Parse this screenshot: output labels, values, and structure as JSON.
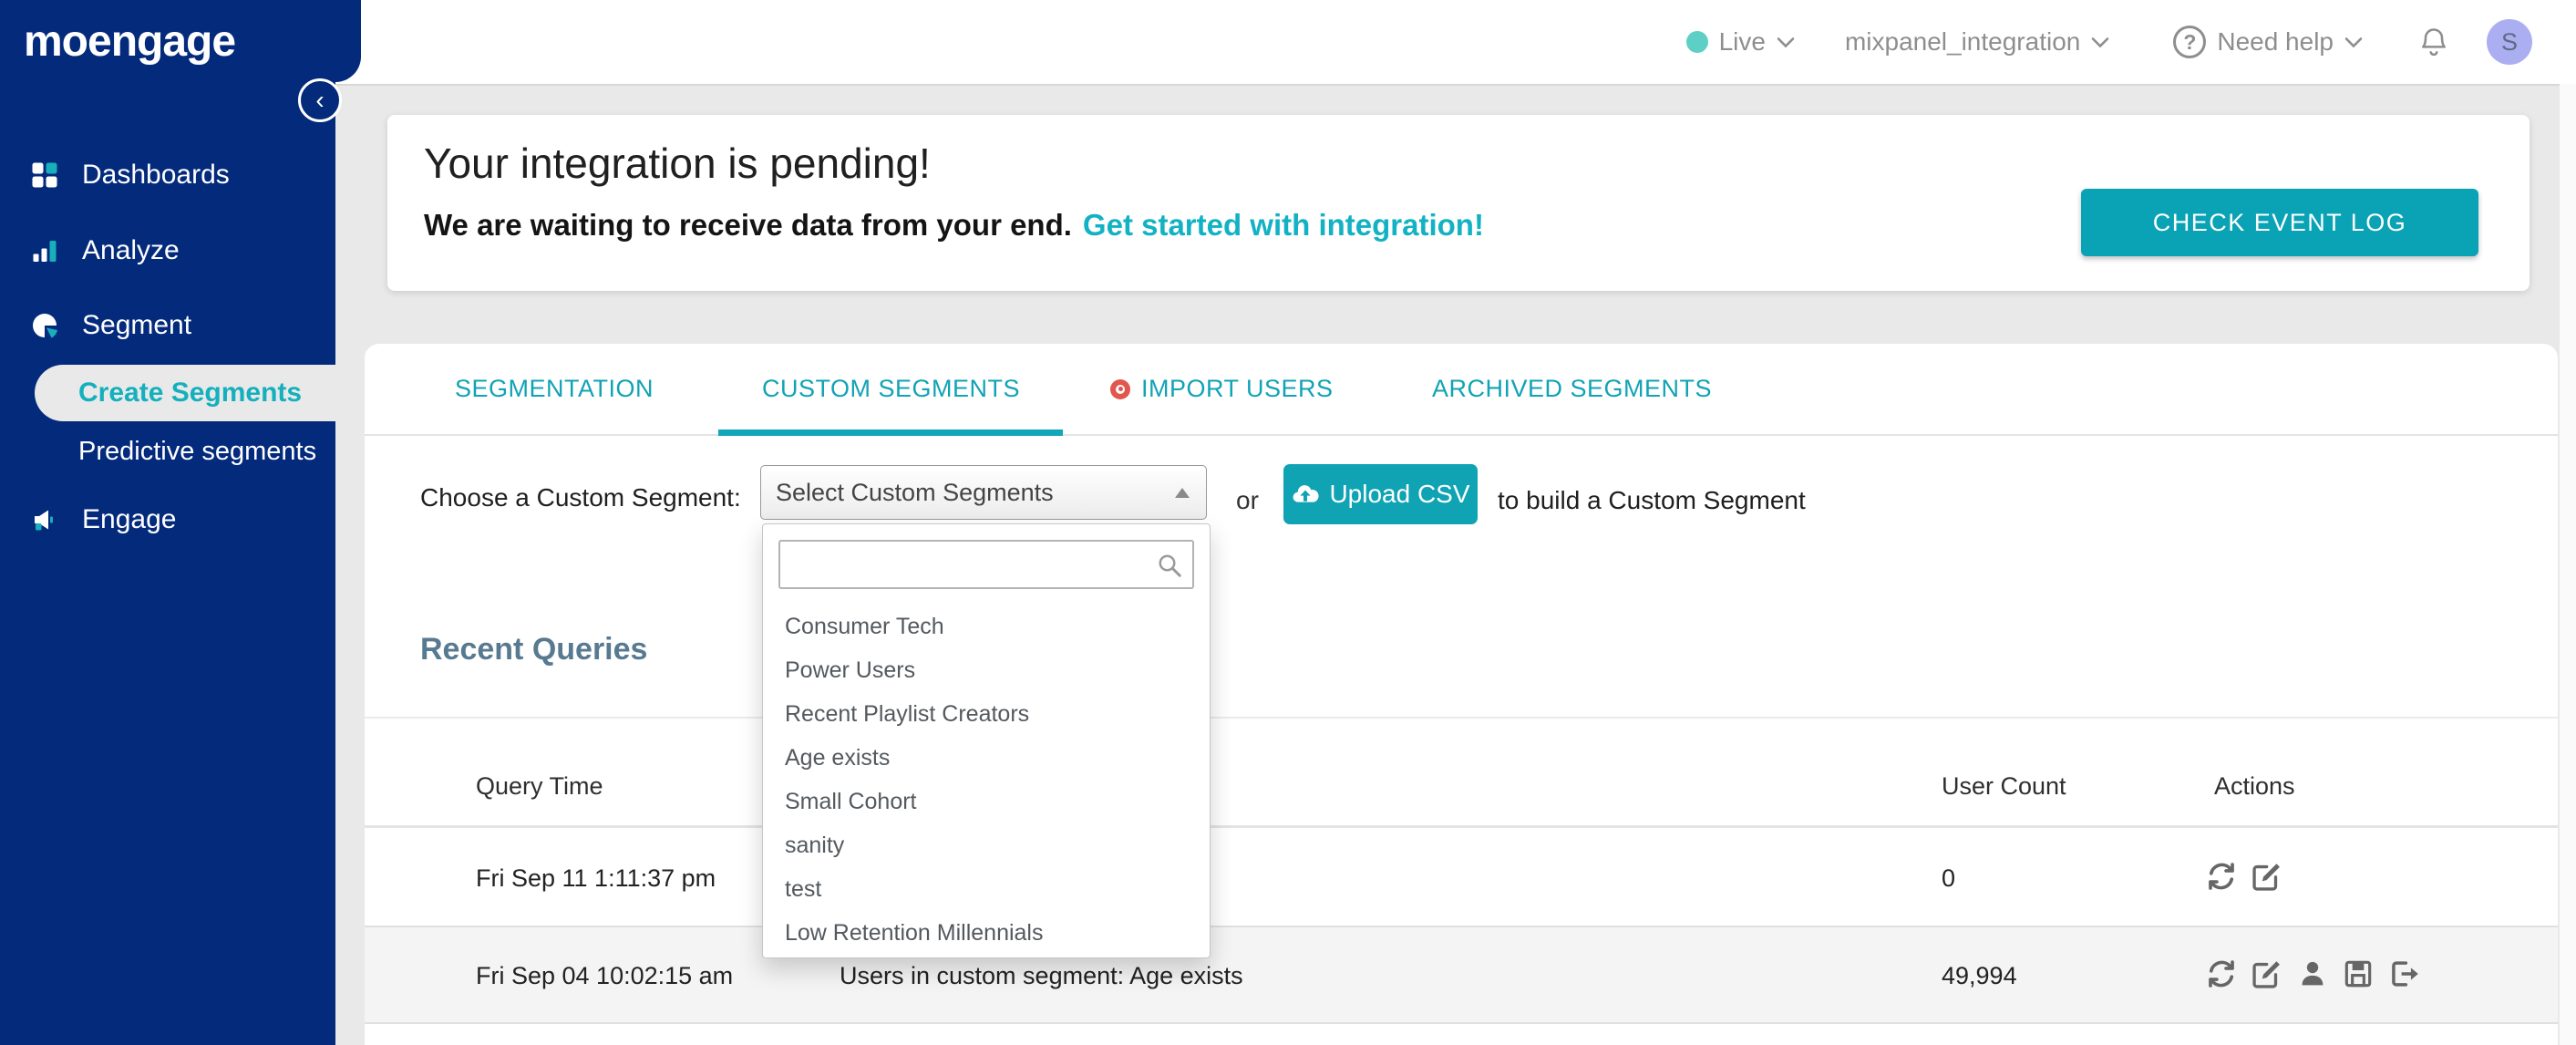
{
  "colors": {
    "navy": "#042a7c",
    "accent_teal": "#0fa3b3",
    "link_teal": "#12b2c4",
    "live_dot": "#5ecfc5",
    "avatar_bg": "#abaff1",
    "heading_blue": "#587a91",
    "import_dot_red": "#e2574d"
  },
  "sidebar": {
    "logo": "moengage",
    "items": [
      {
        "label": "Dashboards"
      },
      {
        "label": "Analyze"
      },
      {
        "label": "Segment"
      },
      {
        "label": "Create Segments",
        "active": true
      },
      {
        "label": "Predictive segments"
      },
      {
        "label": "Engage"
      }
    ]
  },
  "header": {
    "environment": "Live",
    "project": "mixpanel_integration",
    "help": "Need help",
    "avatar_initial": "S"
  },
  "banner": {
    "title": "Your integration is pending!",
    "message": "We are waiting to receive data from your end.",
    "link": "Get started with integration!",
    "button": "CHECK EVENT LOG"
  },
  "tabs": [
    {
      "label": "SEGMENTATION"
    },
    {
      "label": "CUSTOM SEGMENTS",
      "active": true
    },
    {
      "label": "IMPORT USERS"
    },
    {
      "label": "ARCHIVED SEGMENTS"
    }
  ],
  "chooser": {
    "label": "Choose a Custom Segment:",
    "select_value": "Select Custom Segments",
    "conjunction": "or",
    "upload_button": "Upload CSV",
    "suffix": "to build a Custom Segment",
    "search_value": ""
  },
  "custom_segments_dropdown": [
    "Consumer Tech",
    "Power Users",
    "Recent Playlist Creators",
    "Age exists",
    "Small Cohort",
    "sanity",
    "test",
    "Low Retention Millennials"
  ],
  "recent_queries": {
    "title": "Recent Queries",
    "columns": {
      "time": "Query Time",
      "count": "User Count",
      "actions": "Actions"
    },
    "rows": [
      {
        "query_time": "Fri Sep 11 1:11:37 pm",
        "query": "",
        "user_count": "0"
      },
      {
        "query_time": "Fri Sep 04 10:02:15 am",
        "query": "Users in custom segment: Age exists",
        "user_count": "49,994"
      }
    ]
  }
}
